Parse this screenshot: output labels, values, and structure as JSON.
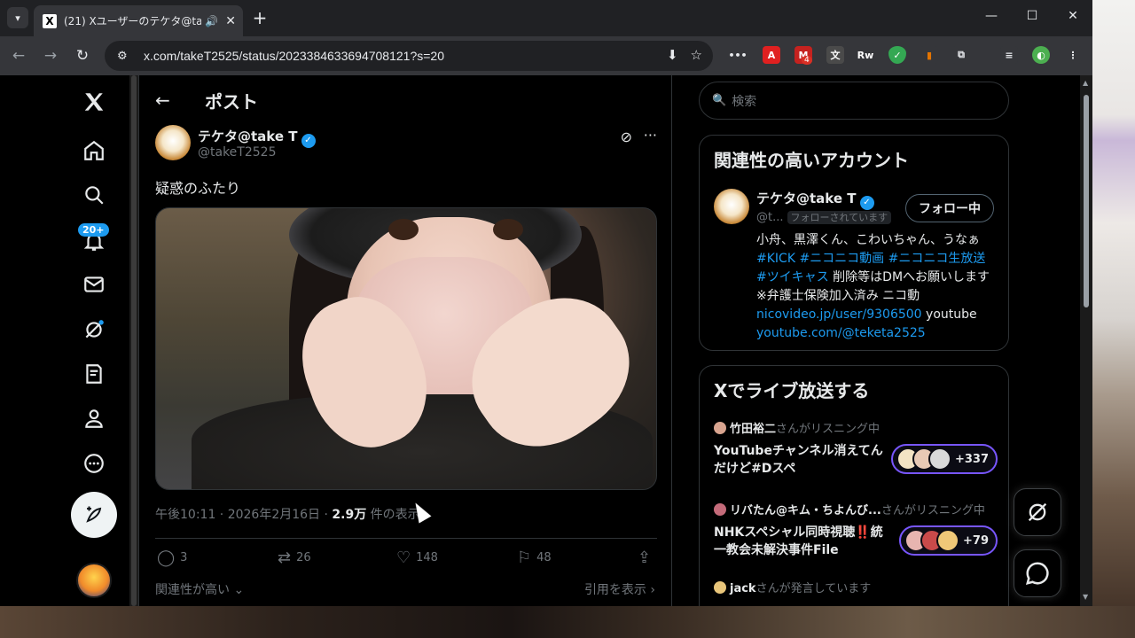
{
  "browser": {
    "tab_title": "(21) Xユーザーのテケタ@take T",
    "tab_favicon": "X",
    "url": "x.com/takeT2525/status/2023384633694708121?s=20",
    "extension_badge": "4"
  },
  "header": {
    "title": "ポスト"
  },
  "nav": {
    "notifications_badge": "20+"
  },
  "post": {
    "author_name": "テケタ@take T",
    "author_handle": "@takeT2525",
    "text": "疑惑のふたり",
    "time": "午後10:11 · 2026年2月16日 · ",
    "views_count": "2.9万",
    "views_label": " 件の表示",
    "replies": "3",
    "reposts": "26",
    "likes": "148",
    "bookmarks": "48",
    "relevance_label": "関連性が高い",
    "quotes_label": "引用を表示"
  },
  "search": {
    "placeholder": "検索"
  },
  "related": {
    "title": "関連性の高いアカウント",
    "name": "テケタ@take T",
    "handle": "@t...",
    "follows_you": "フォローされています",
    "follow_button": "フォロー中",
    "bio_text1": "小舟、黒澤くん、こわいちゃん、うなぁ ",
    "bio_tag1": "#KICK",
    "bio_tag2": "#ニコニコ動画",
    "bio_tag3": "#ニコニコ生放送",
    "bio_tag4": "#ツイキャス",
    "bio_text2": " 削除等はDMへお願いします ※弁護士保険加入済み ニコ動 ",
    "bio_link1": "nicovideo.jp/user/9306500",
    "bio_text3": " youtube ",
    "bio_link2": "youtube.com/@teketa2525"
  },
  "live": {
    "title": "Xでライブ放送する",
    "spaces": [
      {
        "host": "竹田裕二",
        "status": "さんがリスニング中",
        "title": "YouTubeチャンネル消えてんだけど#Dスペ",
        "listeners": "+337"
      },
      {
        "host": "リバたん@キム・ちよんび...",
        "status": "さんがリスニング中",
        "title": "NHKスペシャル同時視聴‼️統一教会未解決事件File",
        "listeners": "+79"
      },
      {
        "host": "jack",
        "status": "さんが発言しています",
        "title": "",
        "listeners": ""
      }
    ]
  },
  "colors": {
    "accent": "#1d9bf0",
    "space_border": "#7856ff",
    "background": "#000000"
  }
}
